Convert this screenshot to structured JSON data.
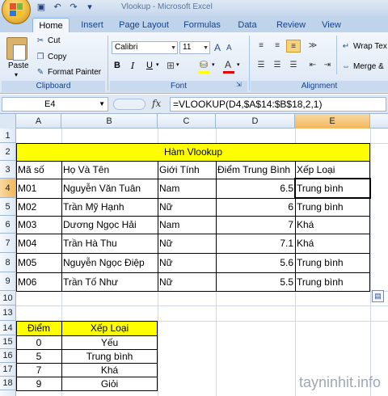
{
  "window": {
    "title": "Vlookup - Microsoft Excel"
  },
  "qat": {
    "icons": [
      "save-icon",
      "undo-icon",
      "redo-icon",
      "customize-icon"
    ]
  },
  "tabs": [
    "Home",
    "Insert",
    "Page Layout",
    "Formulas",
    "Data",
    "Review",
    "View"
  ],
  "ribbon": {
    "clipboard": {
      "label": "Clipboard",
      "paste": "Paste",
      "cut": "Cut",
      "copy": "Copy",
      "format_painter": "Format Painter"
    },
    "font": {
      "label": "Font",
      "name": "Calibri",
      "size": "11"
    },
    "alignment": {
      "label": "Alignment",
      "wrap_text": "Wrap Tex",
      "merge": "Merge &"
    }
  },
  "formula_bar": {
    "name_box": "E4",
    "fx": "fx",
    "formula": "=VLOOKUP(D4,$A$14:$B$18,2,1)"
  },
  "columns": [
    "A",
    "B",
    "C",
    "D",
    "E"
  ],
  "rows": [
    "1",
    "2",
    "3",
    "4",
    "5",
    "6",
    "7",
    "8",
    "9",
    "10",
    "13",
    "14",
    "15",
    "16",
    "17",
    "18"
  ],
  "sheet": {
    "title": "Hàm Vlookup",
    "headers": [
      "Mã số",
      "Họ Và Tên",
      "Giới Tính",
      "Điểm Trung Bình",
      "Xếp Loại"
    ],
    "data": [
      [
        "M01",
        "Nguyễn Văn Tuân",
        "Nam",
        "6.5",
        "Trung bình"
      ],
      [
        "M02",
        "Trần Mỹ Hạnh",
        "Nữ",
        "6",
        "Trung bình"
      ],
      [
        "M03",
        "Dương Ngọc Hải",
        "Nam",
        "7",
        "Khá"
      ],
      [
        "M04",
        "Trần Hà Thu",
        "Nữ",
        "7.1",
        "Khá"
      ],
      [
        "M05",
        "Nguyễn Ngọc Điệp",
        "Nữ",
        "5.6",
        "Trung bình"
      ],
      [
        "M06",
        "Trần Tố Như",
        "Nữ",
        "5.5",
        "Trung bình"
      ]
    ],
    "lookup_headers": [
      "Điểm",
      "Xếp Loại"
    ],
    "lookup": [
      [
        "0",
        "Yếu"
      ],
      [
        "5",
        "Trung bình"
      ],
      [
        "7",
        "Khá"
      ],
      [
        "9",
        "Giỏi"
      ]
    ]
  },
  "watermark": "tayninhit.info",
  "colors": {
    "highlight": "#ffff00",
    "selected_header": "#f1b75c",
    "ribbon": "#dbe6f4"
  }
}
